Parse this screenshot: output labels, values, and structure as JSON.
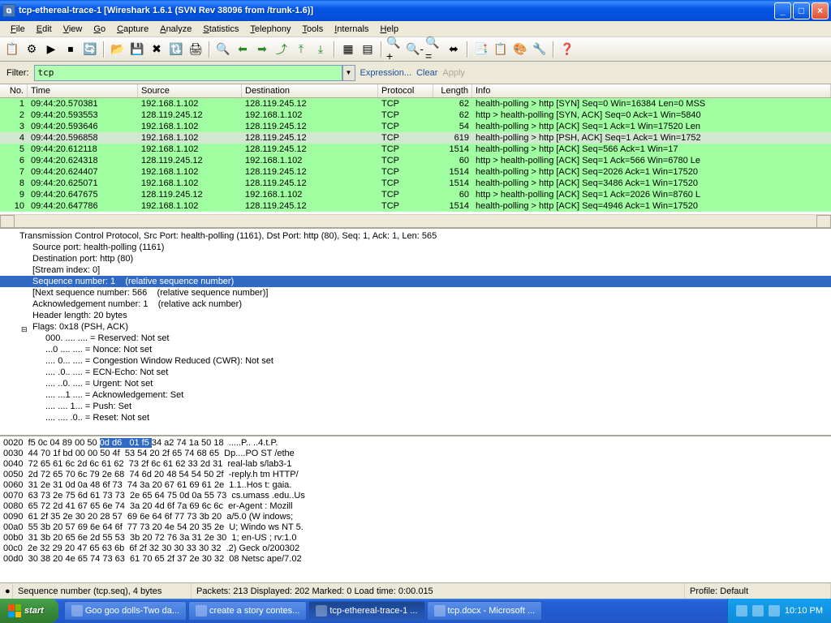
{
  "window": {
    "title": "tcp-ethereal-trace-1   [Wireshark 1.6.1  (SVN Rev 38096 from /trunk-1.6)]"
  },
  "menu": {
    "items": [
      "File",
      "Edit",
      "View",
      "Go",
      "Capture",
      "Analyze",
      "Statistics",
      "Telephony",
      "Tools",
      "Internals",
      "Help"
    ]
  },
  "filter": {
    "label": "Filter:",
    "value": "tcp",
    "expression": "Expression...",
    "clear": "Clear",
    "apply": "Apply"
  },
  "packet_list": {
    "headers": [
      "No.",
      "Time",
      "Source",
      "Destination",
      "Protocol",
      "Length",
      "Info"
    ],
    "rows": [
      {
        "no": "1",
        "time": "09:44:20.570381",
        "src": "192.168.1.102",
        "dst": "128.119.245.12",
        "proto": "TCP",
        "len": "62",
        "info": "health-polling > http [SYN] Seq=0 Win=16384 Len=0 MSS",
        "cls": "green"
      },
      {
        "no": "2",
        "time": "09:44:20.593553",
        "src": "128.119.245.12",
        "dst": "192.168.1.102",
        "proto": "TCP",
        "len": "62",
        "info": "http > health-polling [SYN, ACK] Seq=0 Ack=1 Win=5840",
        "cls": "green"
      },
      {
        "no": "3",
        "time": "09:44:20.593646",
        "src": "192.168.1.102",
        "dst": "128.119.245.12",
        "proto": "TCP",
        "len": "54",
        "info": "health-polling > http [ACK] Seq=1 Ack=1 Win=17520 Len",
        "cls": "green"
      },
      {
        "no": "4",
        "time": "09:44:20.596858",
        "src": "192.168.1.102",
        "dst": "128.119.245.12",
        "proto": "TCP",
        "len": "619",
        "info": "health-polling > http [PSH, ACK] Seq=1 Ack=1 Win=1752",
        "cls": "sel"
      },
      {
        "no": "5",
        "time": "09:44:20.612118",
        "src": "192.168.1.102",
        "dst": "128.119.245.12",
        "proto": "TCP",
        "len": "1514",
        "info": "health-polling > http [ACK] Seq=566 Ack=1 Win=17",
        "cls": "green"
      },
      {
        "no": "6",
        "time": "09:44:20.624318",
        "src": "128.119.245.12",
        "dst": "192.168.1.102",
        "proto": "TCP",
        "len": "60",
        "info": "http > health-polling [ACK] Seq=1 Ack=566 Win=6780 Le",
        "cls": "green"
      },
      {
        "no": "7",
        "time": "09:44:20.624407",
        "src": "192.168.1.102",
        "dst": "128.119.245.12",
        "proto": "TCP",
        "len": "1514",
        "info": "health-polling > http [ACK] Seq=2026 Ack=1 Win=17520",
        "cls": "green"
      },
      {
        "no": "8",
        "time": "09:44:20.625071",
        "src": "192.168.1.102",
        "dst": "128.119.245.12",
        "proto": "TCP",
        "len": "1514",
        "info": "health-polling > http [ACK] Seq=3486 Ack=1 Win=17520",
        "cls": "green"
      },
      {
        "no": "9",
        "time": "09:44:20.647675",
        "src": "128.119.245.12",
        "dst": "192.168.1.102",
        "proto": "TCP",
        "len": "60",
        "info": "http > health-polling [ACK] Seq=1 Ack=2026 Win=8760 L",
        "cls": "green"
      },
      {
        "no": "10",
        "time": "09:44:20.647786",
        "src": "192.168.1.102",
        "dst": "128.119.245.12",
        "proto": "TCP",
        "len": "1514",
        "info": "health-polling > http [ACK] Seq=4946 Ack=1 Win=17520",
        "cls": "green"
      }
    ]
  },
  "details": {
    "lines": [
      {
        "t": "Transmission Control Protocol, Src Port: health-polling (1161), Dst Port: http (80), Seq: 1, Ack: 1, Len: 565",
        "lvl": 1,
        "cut": true
      },
      {
        "t": "Source port: health-polling (1161)",
        "lvl": 2
      },
      {
        "t": "Destination port: http (80)",
        "lvl": 2
      },
      {
        "t": "[Stream index: 0]",
        "lvl": 2
      },
      {
        "t": "Sequence number: 1    (relative sequence number)",
        "lvl": 2,
        "sel": true
      },
      {
        "t": "[Next sequence number: 566    (relative sequence number)]",
        "lvl": 2
      },
      {
        "t": "Acknowledgement number: 1    (relative ack number)",
        "lvl": 2
      },
      {
        "t": "Header length: 20 bytes",
        "lvl": 2
      },
      {
        "t": "Flags: 0x18 (PSH, ACK)",
        "lvl": 2,
        "exp": true
      },
      {
        "t": "000. .... .... = Reserved: Not set",
        "lvl": 3
      },
      {
        "t": "...0 .... .... = Nonce: Not set",
        "lvl": 3
      },
      {
        "t": ".... 0... .... = Congestion Window Reduced (CWR): Not set",
        "lvl": 3
      },
      {
        "t": ".... .0.. .... = ECN-Echo: Not set",
        "lvl": 3
      },
      {
        "t": ".... ..0. .... = Urgent: Not set",
        "lvl": 3
      },
      {
        "t": ".... ...1 .... = Acknowledgement: Set",
        "lvl": 3
      },
      {
        "t": ".... .... 1... = Push: Set",
        "lvl": 3
      },
      {
        "t": ".... .... .0.. = Reset: Not set",
        "lvl": 3
      }
    ]
  },
  "hex": {
    "lines": [
      {
        "off": "0020",
        "h1": "f5 0c 04 89 00 50 ",
        "hl": "0d d6   01 f5 ",
        "h2": "34 a2 74 1a 50 18",
        "a": "  .....P.. ..4.t.P."
      },
      {
        "off": "0030",
        "h1": "44 70 1f bd 00 00 50 4f  53 54 20 2f 65 74 68 65",
        "hl": "",
        "h2": "",
        "a": "  Dp....PO ST /ethe"
      },
      {
        "off": "0040",
        "h1": "72 65 61 6c 2d 6c 61 62  73 2f 6c 61 62 33 2d 31",
        "hl": "",
        "h2": "",
        "a": "  real-lab s/lab3-1"
      },
      {
        "off": "0050",
        "h1": "2d 72 65 70 6c 79 2e 68  74 6d 20 48 54 54 50 2f",
        "hl": "",
        "h2": "",
        "a": "  -reply.h tm HTTP/"
      },
      {
        "off": "0060",
        "h1": "31 2e 31 0d 0a 48 6f 73  74 3a 20 67 61 69 61 2e",
        "hl": "",
        "h2": "",
        "a": "  1.1..Hos t: gaia."
      },
      {
        "off": "0070",
        "h1": "63 73 2e 75 6d 61 73 73  2e 65 64 75 0d 0a 55 73",
        "hl": "",
        "h2": "",
        "a": "  cs.umass .edu..Us"
      },
      {
        "off": "0080",
        "h1": "65 72 2d 41 67 65 6e 74  3a 20 4d 6f 7a 69 6c 6c",
        "hl": "",
        "h2": "",
        "a": "  er-Agent : Mozill"
      },
      {
        "off": "0090",
        "h1": "61 2f 35 2e 30 20 28 57  69 6e 64 6f 77 73 3b 20",
        "hl": "",
        "h2": "",
        "a": "  a/5.0 (W indows; "
      },
      {
        "off": "00a0",
        "h1": "55 3b 20 57 69 6e 64 6f  77 73 20 4e 54 20 35 2e",
        "hl": "",
        "h2": "",
        "a": "  U; Windo ws NT 5."
      },
      {
        "off": "00b0",
        "h1": "31 3b 20 65 6e 2d 55 53  3b 20 72 76 3a 31 2e 30",
        "hl": "",
        "h2": "",
        "a": "  1; en-US ; rv:1.0"
      },
      {
        "off": "00c0",
        "h1": "2e 32 29 20 47 65 63 6b  6f 2f 32 30 30 33 30 32",
        "hl": "",
        "h2": "",
        "a": "  .2) Geck o/200302"
      },
      {
        "off": "00d0",
        "h1": "30 38 20 4e 65 74 73 63  61 70 65 2f 37 2e 30 32",
        "hl": "",
        "h2": "",
        "a": "  08 Netsc ape/7.02"
      }
    ]
  },
  "statusbar": {
    "field": "Sequence number (tcp.seq), 4 bytes",
    "packets": "Packets: 213 Displayed: 202 Marked: 0 Load time: 0:00.015",
    "profile": "Profile: Default"
  },
  "taskbar": {
    "start": "start",
    "items": [
      "Goo goo dolls-Two da...",
      "create a story contes...",
      "tcp-ethereal-trace-1 ...",
      "tcp.docx - Microsoft ..."
    ],
    "time": "10:10 PM"
  }
}
